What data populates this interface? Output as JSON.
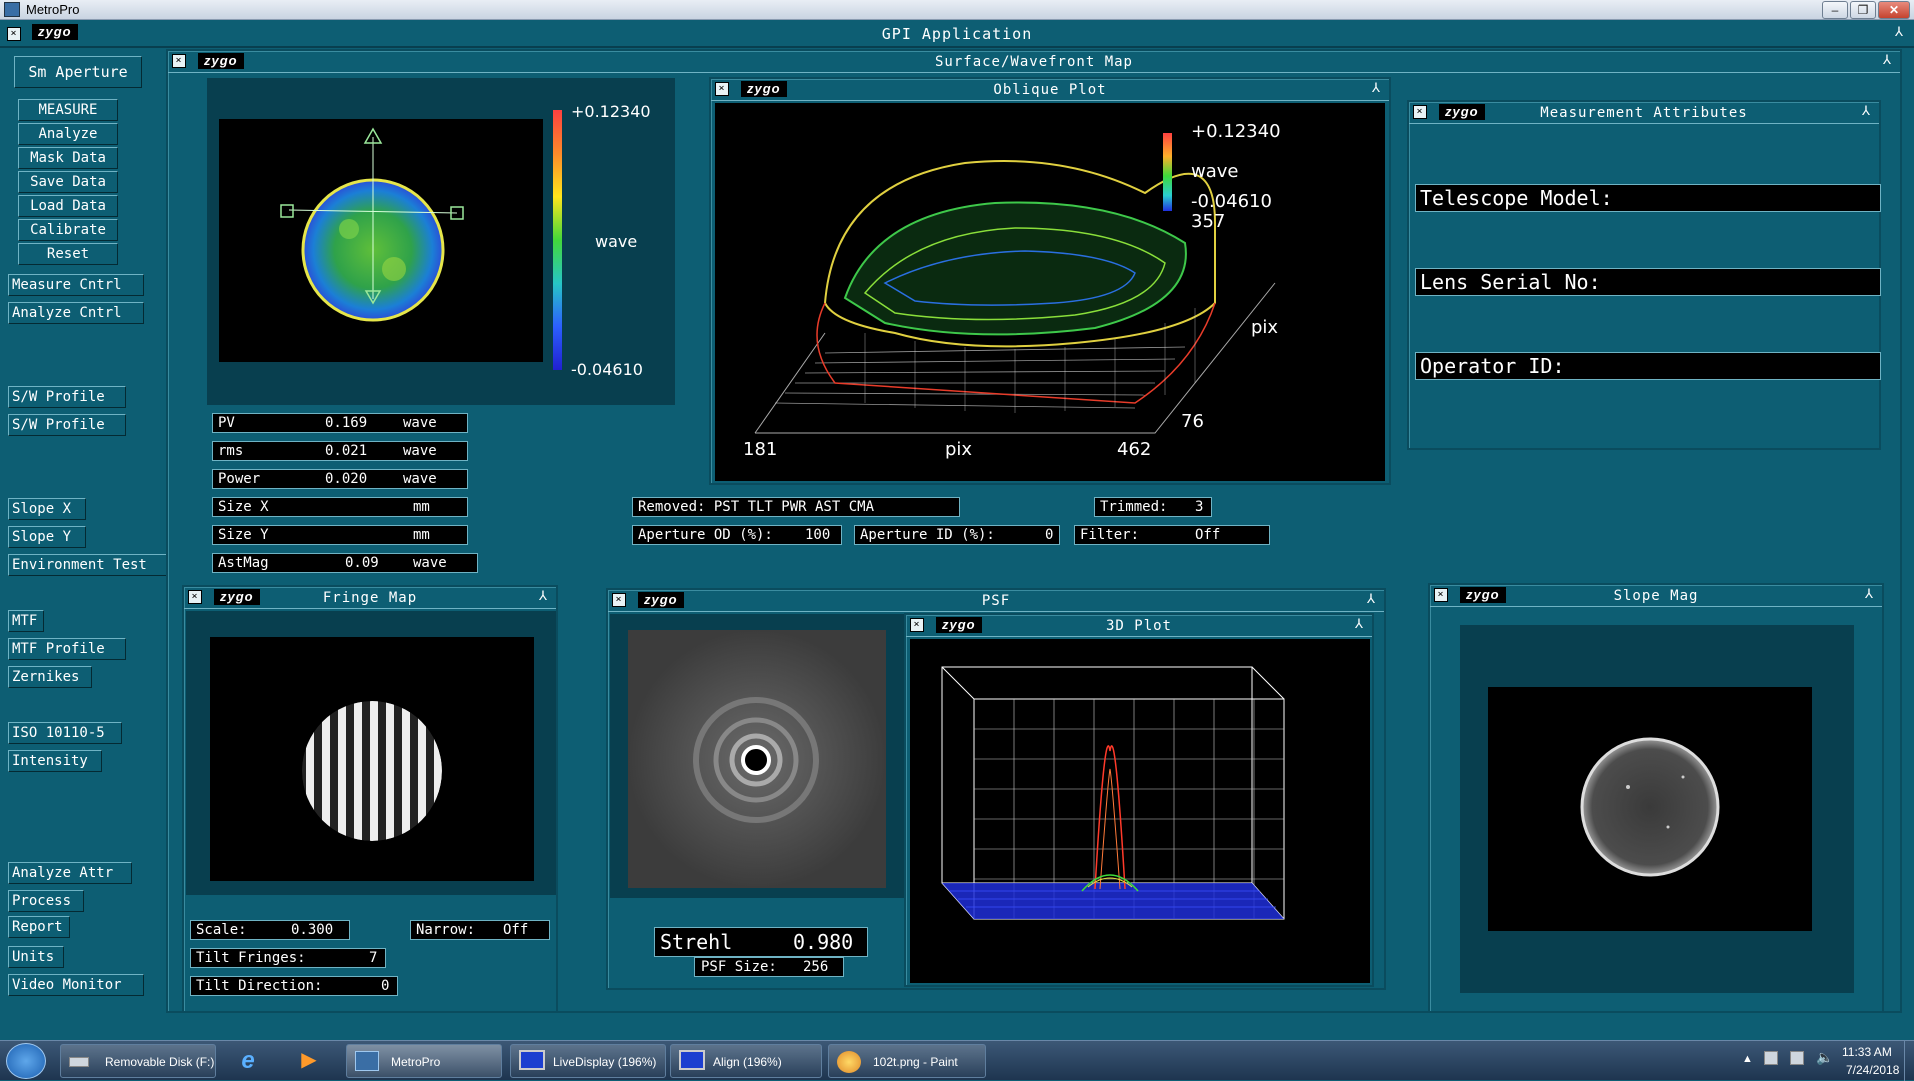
{
  "window": {
    "title": "MetroPro"
  },
  "app": {
    "title": "GPI Application",
    "brand": "zygo"
  },
  "left_buttons": [
    {
      "id": "sm-aperture",
      "label": "Sm Aperture"
    },
    {
      "id": "measure",
      "label": "MEASURE"
    },
    {
      "id": "analyze",
      "label": "Analyze"
    },
    {
      "id": "mask-data",
      "label": "Mask Data"
    },
    {
      "id": "save-data",
      "label": "Save Data"
    },
    {
      "id": "load-data",
      "label": "Load Data"
    },
    {
      "id": "calibrate",
      "label": "Calibrate"
    },
    {
      "id": "reset",
      "label": "Reset"
    },
    {
      "id": "measure-cntrl",
      "label": "Measure Cntrl"
    },
    {
      "id": "analyze-cntrl",
      "label": "Analyze Cntrl"
    },
    {
      "id": "sw-profile-1",
      "label": "S/W Profile"
    },
    {
      "id": "sw-profile-2",
      "label": "S/W Profile"
    },
    {
      "id": "slope-x",
      "label": "Slope X"
    },
    {
      "id": "slope-y",
      "label": "Slope Y"
    },
    {
      "id": "environment-test",
      "label": "Environment Test"
    },
    {
      "id": "mtf",
      "label": "MTF"
    },
    {
      "id": "mtf-profile",
      "label": "MTF Profile"
    },
    {
      "id": "zernikes",
      "label": "Zernikes"
    },
    {
      "id": "iso-10110-5",
      "label": "ISO 10110-5"
    },
    {
      "id": "intensity",
      "label": "Intensity"
    },
    {
      "id": "analyze-attr",
      "label": "Analyze Attr"
    },
    {
      "id": "process",
      "label": "Process"
    },
    {
      "id": "report",
      "label": "Report"
    },
    {
      "id": "units",
      "label": "Units"
    },
    {
      "id": "video-monitor",
      "label": "Video Monitor"
    }
  ],
  "surface": {
    "title": "Surface/Wavefront Map",
    "scale_max": "+0.12340",
    "scale_min": "-0.04610",
    "scale_unit": "wave",
    "results": [
      {
        "label": "PV",
        "value": "0.169",
        "unit": "wave"
      },
      {
        "label": "rms",
        "value": "0.021",
        "unit": "wave"
      },
      {
        "label": "Power",
        "value": "0.020",
        "unit": "wave"
      },
      {
        "label": "Size X",
        "value": "",
        "unit": "mm"
      },
      {
        "label": "Size Y",
        "value": "",
        "unit": "mm"
      },
      {
        "label": "AstMag",
        "value": "0.09",
        "unit": "wave"
      }
    ],
    "removed": "Removed: PST TLT PWR AST CMA",
    "trimmed_label": "Trimmed:",
    "trimmed_value": "3",
    "aperture_od_label": "Aperture OD (%):",
    "aperture_od_value": "100",
    "aperture_id_label": "Aperture ID (%):",
    "aperture_id_value": "0",
    "filter_label": "Filter:",
    "filter_value": "Off"
  },
  "oblique": {
    "title": "Oblique Plot",
    "scale_max": "+0.12340",
    "scale_unit": "wave",
    "scale_min": "-0.04610",
    "y_max": "357",
    "y_label": "pix",
    "y_min": "76",
    "x_min": "181",
    "x_label": "pix",
    "x_max": "462"
  },
  "attributes": {
    "title": "Measurement Attributes",
    "fields": [
      {
        "id": "telescope-model",
        "label": "Telescope Model:"
      },
      {
        "id": "lens-serial-no",
        "label": "Lens Serial No:"
      },
      {
        "id": "operator-id",
        "label": "Operator ID:"
      }
    ]
  },
  "fringe": {
    "title": "Fringe Map",
    "scale_label": "Scale:",
    "scale_value": "0.300",
    "narrow_label": "Narrow:",
    "narrow_value": "Off",
    "tilt_fringes_label": "Tilt Fringes:",
    "tilt_fringes_value": "7",
    "tilt_direction_label": "Tilt Direction:",
    "tilt_direction_value": "0"
  },
  "psf": {
    "title": "PSF",
    "strehl_label": "Strehl",
    "strehl_value": "0.980",
    "size_label": "PSF Size:",
    "size_value": "256"
  },
  "plot3d": {
    "title": "3D Plot"
  },
  "slope": {
    "title": "Slope Mag"
  },
  "taskbar": {
    "items": [
      {
        "id": "removable-disk",
        "label": "Removable Disk (F:)"
      },
      {
        "id": "metropro",
        "label": "MetroPro"
      },
      {
        "id": "livedisplay",
        "label": "LiveDisplay (196%)"
      },
      {
        "id": "align",
        "label": "Align (196%)"
      },
      {
        "id": "paint",
        "label": "102t.png - Paint"
      }
    ],
    "time": "11:33 AM",
    "date": "7/24/2018"
  },
  "colors": {
    "background": "#0d5e73",
    "accent": "#ffffff"
  }
}
